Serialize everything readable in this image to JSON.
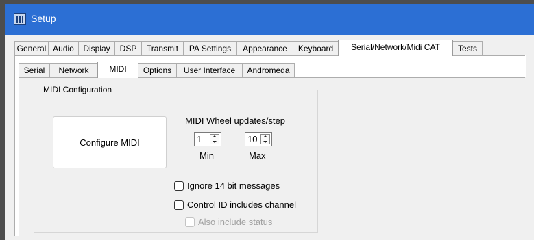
{
  "window": {
    "title": "Setup",
    "icon": "setup-app-icon"
  },
  "main_tabs": [
    {
      "label": "General"
    },
    {
      "label": "Audio"
    },
    {
      "label": "Display"
    },
    {
      "label": "DSP"
    },
    {
      "label": "Transmit"
    },
    {
      "label": "PA Settings"
    },
    {
      "label": "Appearance"
    },
    {
      "label": "Keyboard"
    },
    {
      "label": "Serial/Network/Midi CAT",
      "selected": true
    },
    {
      "label": "Tests"
    }
  ],
  "sub_tabs": [
    {
      "label": "Serial"
    },
    {
      "label": "Network"
    },
    {
      "label": "MIDI",
      "selected": true
    },
    {
      "label": "Options"
    },
    {
      "label": "User Interface"
    },
    {
      "label": "Andromeda"
    }
  ],
  "midi": {
    "group_title": "MIDI Configuration",
    "configure_button": "Configure MIDI",
    "wheel_label": "MIDI Wheel updates/step",
    "min_value": "1",
    "min_label": "Min",
    "max_value": "10",
    "max_label": "Max",
    "ignore_14bit_label": "Ignore 14 bit messages",
    "ignore_14bit_checked": false,
    "control_id_label": "Control ID includes channel",
    "control_id_checked": false,
    "also_status_label": "Also include status",
    "also_status_checked": false,
    "also_status_enabled": false
  }
}
